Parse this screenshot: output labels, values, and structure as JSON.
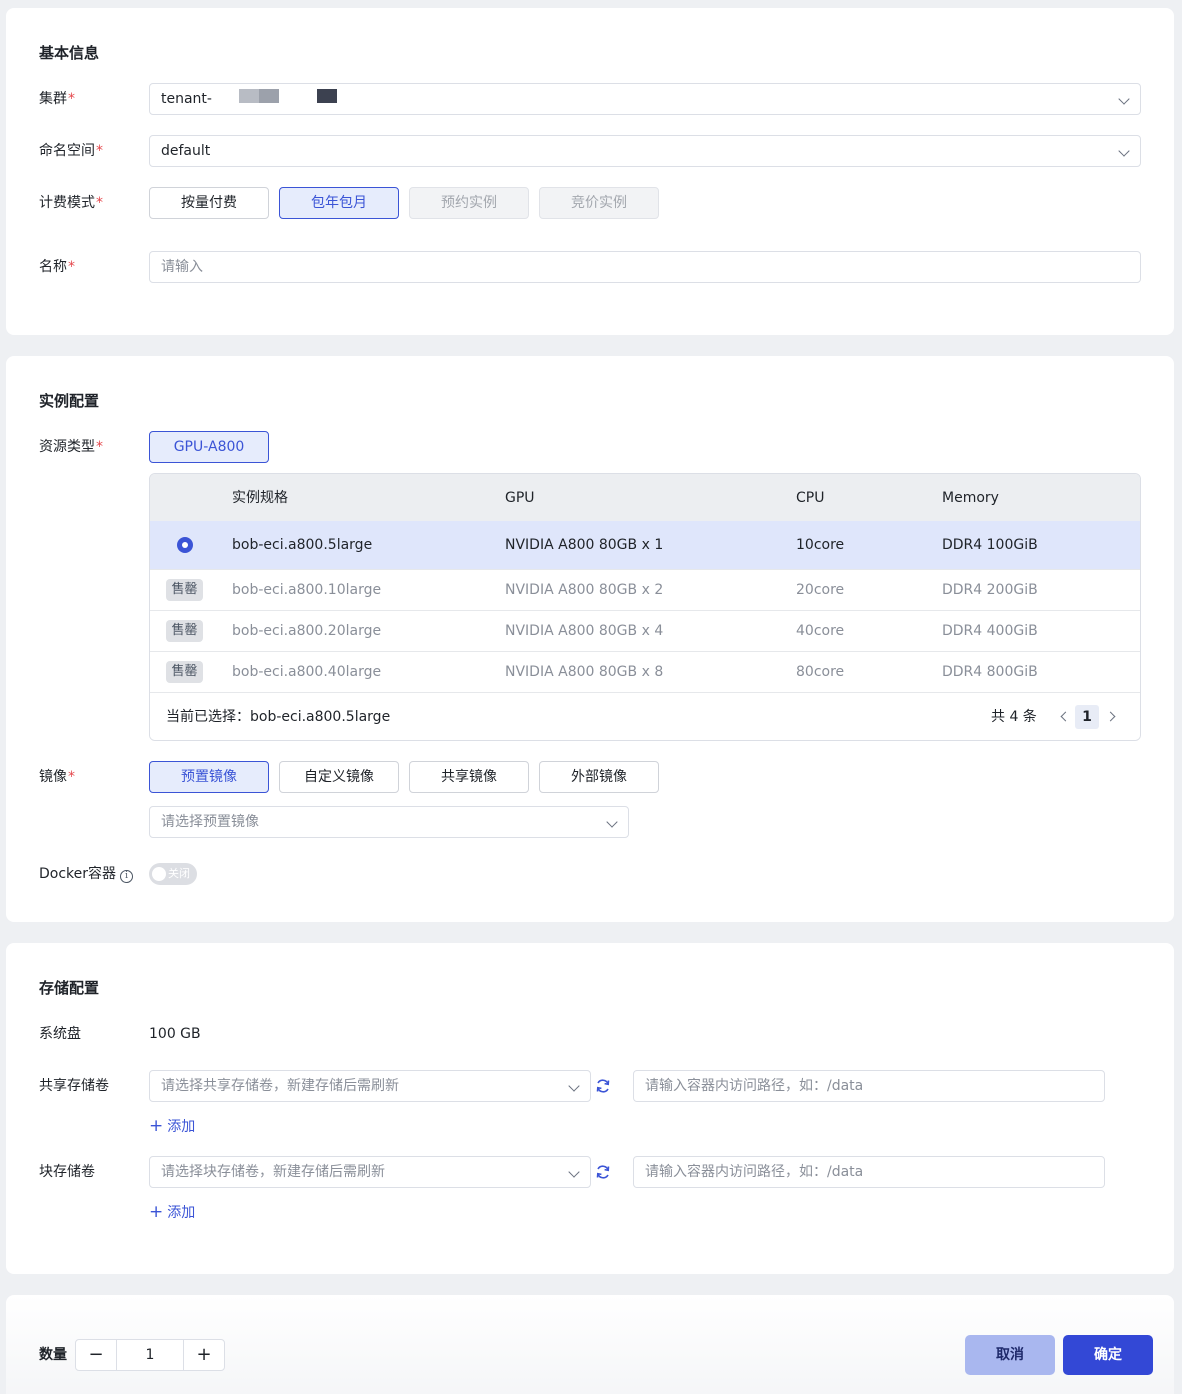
{
  "basic": {
    "title": "基本信息",
    "cluster": {
      "label": "集群",
      "value": "tenant-"
    },
    "namespace": {
      "label": "命名空间",
      "value": "default"
    },
    "billing": {
      "label": "计费模式",
      "options": [
        "按量付费",
        "包年包月",
        "预约实例",
        "竞价实例"
      ],
      "selected": "包年包月"
    },
    "name": {
      "label": "名称",
      "placeholder": "请输入"
    },
    "required_mark": "*"
  },
  "instance": {
    "title": "实例配置",
    "resource_type": {
      "label": "资源类型",
      "value": "GPU-A800"
    },
    "table": {
      "headers": [
        "实例规格",
        "GPU",
        "CPU",
        "Memory"
      ],
      "rows": [
        {
          "status": "selected",
          "spec": "bob-eci.a800.5large",
          "gpu": "NVIDIA A800 80GB x 1",
          "cpu": "10core",
          "memory": "DDR4 100GiB"
        },
        {
          "status": "售罄",
          "spec": "bob-eci.a800.10large",
          "gpu": "NVIDIA A800 80GB x 2",
          "cpu": "20core",
          "memory": "DDR4 200GiB"
        },
        {
          "status": "售罄",
          "spec": "bob-eci.a800.20large",
          "gpu": "NVIDIA A800 80GB x 4",
          "cpu": "40core",
          "memory": "DDR4 400GiB"
        },
        {
          "status": "售罄",
          "spec": "bob-eci.a800.40large",
          "gpu": "NVIDIA A800 80GB x 8",
          "cpu": "80core",
          "memory": "DDR4 800GiB"
        }
      ],
      "current_selection": "当前已选择：bob-eci.a800.5large",
      "total": "共 4 条",
      "page": "1"
    },
    "image": {
      "label": "镜像",
      "options": [
        "预置镜像",
        "自定义镜像",
        "共享镜像",
        "外部镜像"
      ],
      "selected": "预置镜像",
      "placeholder": "请选择预置镜像"
    },
    "docker": {
      "label": "Docker容器",
      "info_icon": "i",
      "toggle_text": "关闭"
    }
  },
  "storage": {
    "title": "存储配置",
    "system_disk": {
      "label": "系统盘",
      "value": "100 GB"
    },
    "shared": {
      "label": "共享存储卷",
      "select_placeholder": "请选择共享存储卷，新建存储后需刷新",
      "path_placeholder": "请输入容器内访问路径，如：/data",
      "add": "添加"
    },
    "block": {
      "label": "块存储卷",
      "select_placeholder": "请选择块存储卷，新建存储后需刷新",
      "path_placeholder": "请输入容器内访问路径，如：/data",
      "add": "添加"
    }
  },
  "footer": {
    "quantity_label": "数量",
    "quantity": "1",
    "minus": "−",
    "plus": "+",
    "cancel": "取消",
    "confirm": "确定"
  },
  "colors": {
    "accent": "#3b54d6",
    "required": "#e5484d",
    "selected_row": "#dfe6fb"
  }
}
